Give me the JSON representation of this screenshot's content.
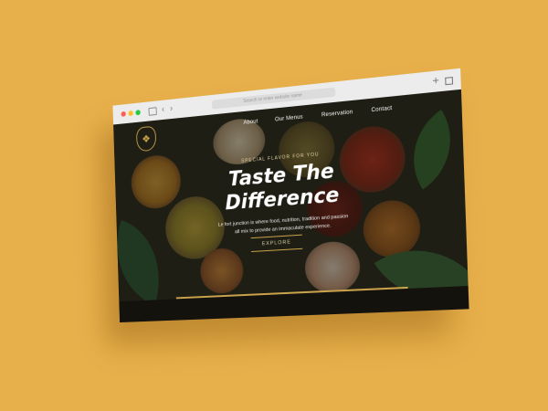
{
  "browser": {
    "url_placeholder": "Search or enter website name"
  },
  "nav": {
    "items": [
      {
        "label": "About"
      },
      {
        "label": "Our Menus"
      },
      {
        "label": "Reservation"
      },
      {
        "label": "Contact"
      }
    ]
  },
  "hero": {
    "tagline": "SPECIAL FLAVOR FOR YOU",
    "title_line1": "Taste The",
    "title_line2": "Difference",
    "description_line1": "Le fort junction is where food, nutrition, tradition and passion",
    "description_line2": "all mix to provide an immaculate experience.",
    "explore_label": "EXPLORE"
  },
  "colors": {
    "background": "#E8B04A",
    "accent_gold": "#C9A24B",
    "chrome": "#ECECEC"
  }
}
